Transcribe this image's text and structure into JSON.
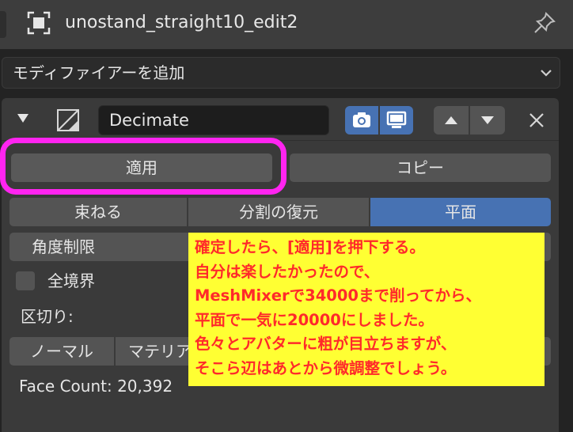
{
  "header": {
    "title": "unostand_straight10_edit2",
    "object_icon": "object-data-icon",
    "pin_icon": "pin-icon"
  },
  "add_modifier": {
    "label": "モディファイアーを追加"
  },
  "modifier": {
    "name": "Decimate",
    "apply_label": "適用",
    "copy_label": "コピー",
    "modes": [
      "束ねる",
      "分割の復元",
      "平面"
    ],
    "selected_mode": "平面",
    "angle_limit_label": "角度制限",
    "all_boundaries_label": "全境界",
    "delimit_label": "区切り:",
    "delimit_options": [
      "ノーマル",
      "マテリア"
    ],
    "face_count": "Face Count: 20,392"
  },
  "annotation": {
    "lines": [
      "確定したら、[適用]を押下する。",
      "自分は楽したかったので、",
      "MeshMixerで34000まで削ってから、",
      "平面で一気に20000にしました。",
      "色々とアバターに粗が目立ちますが、",
      "そこら辺はあとから微調整でしょう。"
    ],
    "highlight_color": "#ff24f0",
    "note_background": "#ffff33",
    "note_text_color": "#ff2a2a"
  },
  "colors": {
    "accent": "#4772b3",
    "panel": "#3a3a3a",
    "button": "#545454"
  }
}
